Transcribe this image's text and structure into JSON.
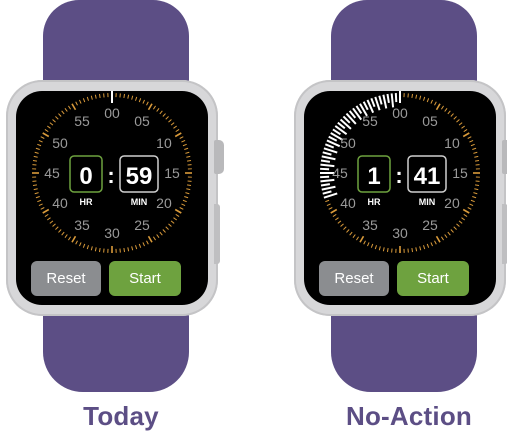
{
  "colors": {
    "band": "#5c4e85",
    "case": "#d7d7d9",
    "tick": "#d99a3a",
    "elapsed_tick": "#ffffff",
    "number": "#9a9a9a",
    "hr_box": "#6ea23f",
    "min_box": "#cfcfcf",
    "reset": "#8b8d90",
    "start": "#6ea23f",
    "caption": "#5c4e85"
  },
  "dial_numbers": [
    "00",
    "05",
    "10",
    "15",
    "20",
    "25",
    "30",
    "35",
    "40",
    "45",
    "50",
    "55"
  ],
  "watches": [
    {
      "caption": "Today",
      "hours": "0",
      "minutes": "59",
      "hr_label": "HR",
      "min_label": "MIN",
      "separator": ":",
      "elapsed_fraction": 0.0,
      "reset_label": "Reset",
      "start_label": "Start"
    },
    {
      "caption": "No-Action",
      "hours": "1",
      "minutes": "41",
      "hr_label": "HR",
      "min_label": "MIN",
      "separator": ":",
      "elapsed_fraction": 0.3,
      "reset_label": "Reset",
      "start_label": "Start"
    }
  ]
}
